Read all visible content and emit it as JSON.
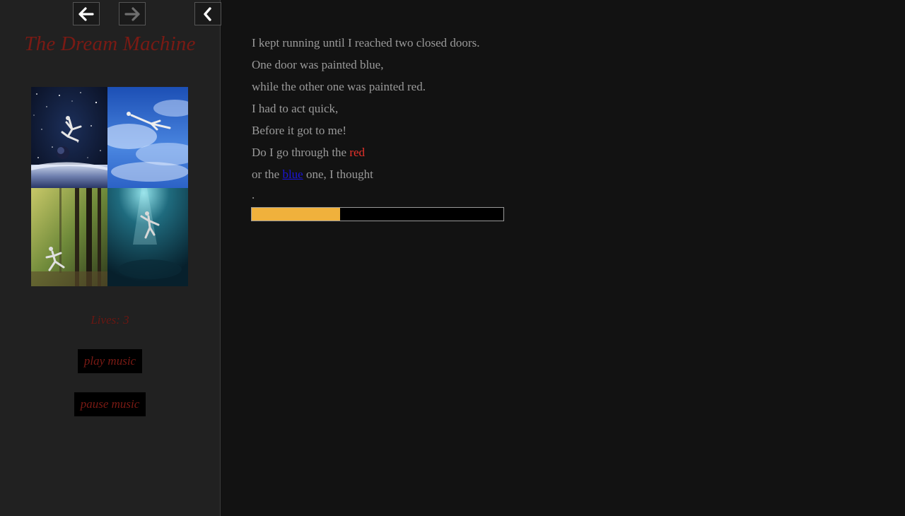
{
  "nav": {
    "back_icon": "arrow-left-icon",
    "forward_icon": "arrow-right-icon",
    "collapse_icon": "chevron-left-icon"
  },
  "sidebar": {
    "title": "The Dream Machine",
    "lives": "Lives: 3",
    "play_music": "play music",
    "pause_music": "pause music"
  },
  "story": {
    "lines": [
      "I kept running until I reached two closed doors.",
      "One door was painted blue,",
      "while the other one was painted red.",
      "I had to act quick,",
      "Before it got to me!"
    ],
    "line6_prefix": "Do I go through the ",
    "line6_choice": "red",
    "line7_prefix": "or the ",
    "line7_choice": "blue",
    "line7_suffix": " one, I thought",
    "trailing": "."
  },
  "progress": {
    "fraction": 0.35
  },
  "colors": {
    "title": "#7a1a14",
    "progress_fill": "#f0b13c",
    "red_choice": "#e8322b",
    "blue_choice": "#1a14d6"
  }
}
